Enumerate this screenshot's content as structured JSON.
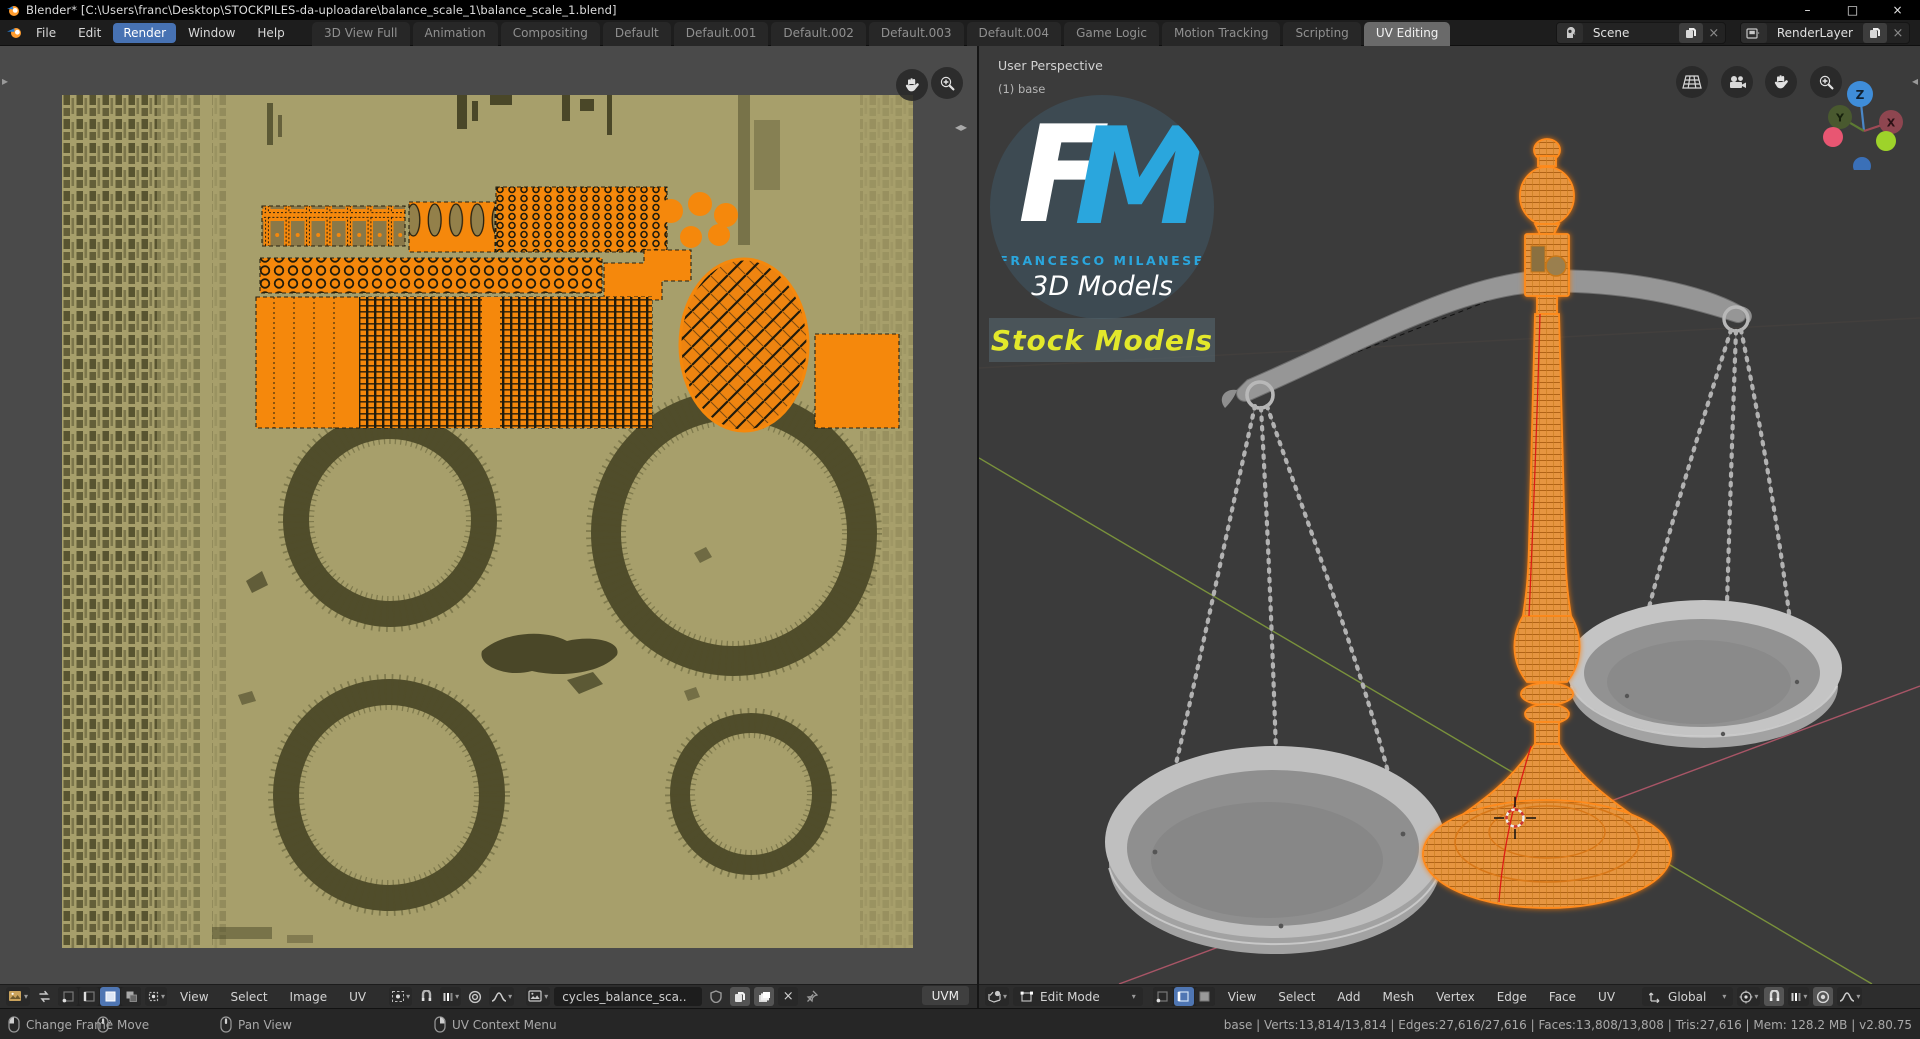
{
  "title_bar": {
    "title": "Blender* [C:\\Users\\franc\\Desktop\\STOCKPILES-da-uploadare\\balance_scale_1\\balance_scale_1.blend]",
    "controls": {
      "minimize": "–",
      "maximize": "□",
      "close": "×"
    }
  },
  "menu_bar": {
    "items": [
      "File",
      "Edit",
      "Render",
      "Window",
      "Help"
    ],
    "active_item": "Render"
  },
  "workspace_tabs": [
    "3D View Full",
    "Animation",
    "Compositing",
    "Default",
    "Default.001",
    "Default.002",
    "Default.003",
    "Default.004",
    "Game Logic",
    "Motion Tracking",
    "Scripting",
    "UV Editing"
  ],
  "active_workspace": "UV Editing",
  "scene_widget": {
    "scene_name": "Scene",
    "render_layer_name": "RenderLayer"
  },
  "uv_editor": {
    "menus": [
      "View",
      "Select",
      "Image",
      "UV"
    ],
    "image_name": "cycles_balance_sca..",
    "uv_map_label": "UVM"
  },
  "viewport_3d": {
    "overlay_view_label": "User Perspective",
    "overlay_object_label": "(1) base",
    "mode_label": "Edit Mode",
    "menus": [
      "View",
      "Select",
      "Add",
      "Mesh",
      "Vertex",
      "Edge",
      "Face",
      "UV"
    ],
    "orientation_label": "Global",
    "gizmo": {
      "x": "X",
      "y": "Y",
      "z": "Z"
    }
  },
  "watermark": {
    "initial_f": "F",
    "initial_m": "M",
    "studio_name": "FRANCESCO MILANESE",
    "studio_sub": "3D Models",
    "badge": "Stock Models"
  },
  "status_bar": {
    "hints": [
      "Change Frame",
      "Move",
      "Pan View",
      "UV Context Menu"
    ],
    "stats": "base | Verts:13,814/13,814 | Edges:27,616/27,616 | Faces:13,808/13,808 | Tris:27,616 | Mem: 128.2 MB | v2.80.75"
  },
  "colors": {
    "accent_blue": "#4772b3",
    "selection_orange": "#f5880c",
    "uv_image_bg": "#a79f6b",
    "uv_pattern_dark": "#54512d",
    "viewport_bg": "#3b3b3b",
    "logo_cyan": "#2aa6dd",
    "badge_yellow": "#e3e82b"
  }
}
